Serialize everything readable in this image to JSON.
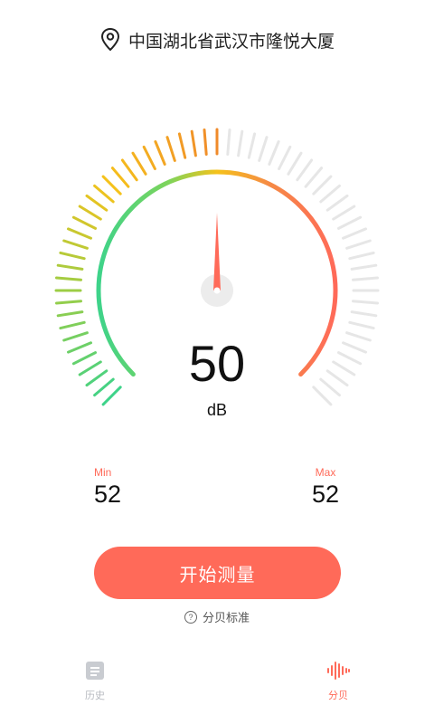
{
  "location": {
    "text": "中国湖北省武汉市隆悦大厦",
    "icon": "location-pin-icon"
  },
  "meter": {
    "value": "50",
    "unit": "dB",
    "scale_max": 100,
    "needle_percent": 50
  },
  "stats": {
    "min_label": "Min",
    "min_value": "52",
    "max_label": "Max",
    "max_value": "52"
  },
  "actions": {
    "start_label": "开始测量",
    "standard_label": "分贝标准",
    "standard_icon": "question-circle-icon"
  },
  "tabs": [
    {
      "label": "历史",
      "icon": "document-icon",
      "active": false
    },
    {
      "label": "分贝",
      "icon": "sound-wave-icon",
      "active": true
    }
  ],
  "colors": {
    "accent": "#ff6a59",
    "green": "#3ed38a",
    "yellow": "#f5c21b",
    "orange": "#f08a2a",
    "inactive": "#e6e6e6"
  }
}
